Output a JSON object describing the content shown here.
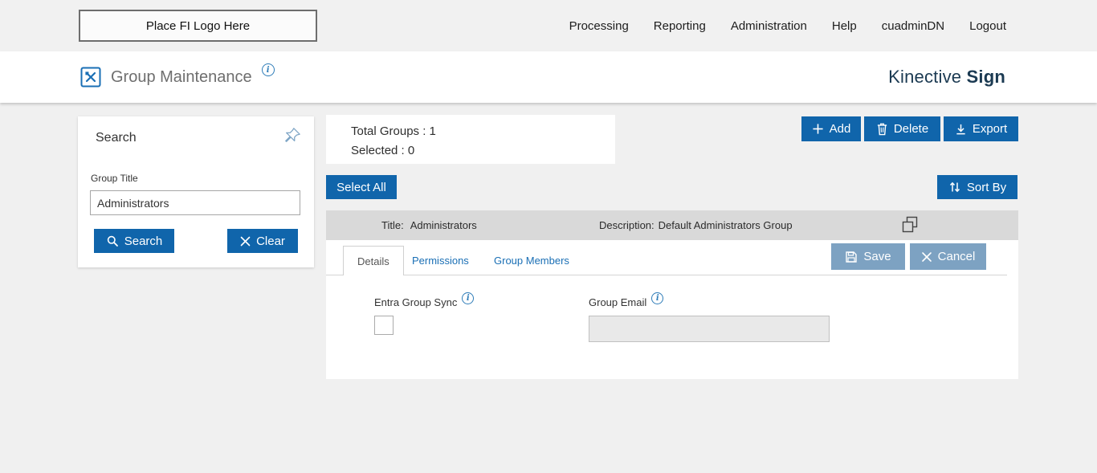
{
  "topbar": {
    "logo_placeholder": "Place FI Logo Here",
    "nav": [
      {
        "label": "Processing"
      },
      {
        "label": "Reporting"
      },
      {
        "label": "Administration"
      },
      {
        "label": "Help"
      },
      {
        "label": "cuadminDN"
      },
      {
        "label": "Logout"
      }
    ]
  },
  "header": {
    "title": "Group Maintenance",
    "brand_first": "Kinective",
    "brand_second": "Sign"
  },
  "icons": {
    "info": "i"
  },
  "search_panel": {
    "title": "Search",
    "group_title_label": "Group Title",
    "group_title_value": "Administrators",
    "search_button": "Search",
    "clear_button": "Clear"
  },
  "summary": {
    "total_groups": "Total Groups : 1",
    "selected": "Selected : 0"
  },
  "toolbar": {
    "add_label": "Add",
    "delete_label": "Delete",
    "export_label": "Export",
    "select_all_label": "Select All",
    "sort_by_label": "Sort By"
  },
  "group_row": {
    "title_label": "Title:",
    "title_value": "Administrators",
    "description_label": "Description:",
    "description_value": "Default Administrators Group"
  },
  "detail_panel": {
    "tabs": [
      {
        "label": "Details"
      },
      {
        "label": "Permissions"
      },
      {
        "label": "Group Members"
      }
    ],
    "save_label": "Save",
    "cancel_label": "Cancel",
    "entra_group_sync_label": "Entra Group Sync",
    "group_email_label": "Group Email",
    "group_email_value": ""
  },
  "colors": {
    "primary_blue": "#1065ab",
    "muted_blue": "#7da2c2",
    "brand_navy": "#1b3a52",
    "link_blue": "#1a6fb5"
  }
}
